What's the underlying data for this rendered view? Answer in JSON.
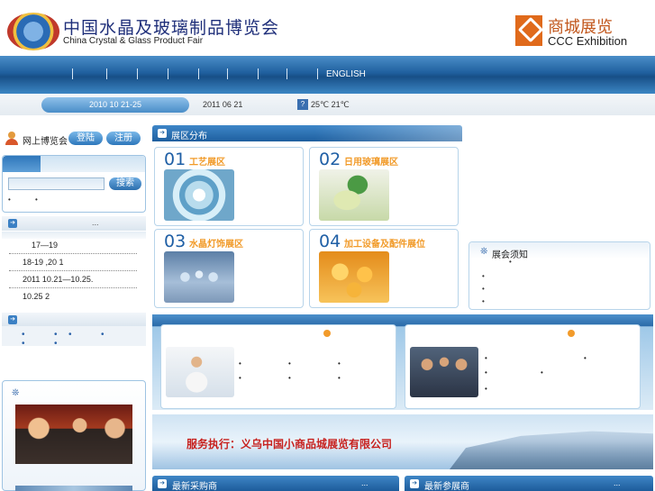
{
  "header": {
    "logo_cn": "中国水晶及玻璃制品博览会",
    "logo_en": "China Crystal &  Glass Product Fair",
    "partner_cn": "商城展览",
    "partner_en": "CCC Exhibition"
  },
  "nav": {
    "items": [
      "|",
      "|",
      "|",
      "|",
      "|",
      "|",
      "|",
      "|",
      "|"
    ],
    "english": "ENGLISH"
  },
  "datebar": {
    "fair_dates": "2010 10 21-25",
    "today": "2011 06 21",
    "weather_icon": "weather-icon",
    "weather": "25℃ 21℃"
  },
  "left": {
    "online_label": "网上博览会",
    "login": "登陆",
    "register": "注册",
    "search_button": "搜索",
    "search_dots": [
      "•",
      "•"
    ],
    "news_more": "...",
    "news": [
      "17—19",
      "18-19 ,20   1",
      "2011 10.21—10.25.",
      "10.25   2"
    ],
    "links": [
      "•",
      "•",
      "•",
      "•",
      "•",
      "•"
    ],
    "photo_icon": "❊"
  },
  "zones": {
    "header_title": "展区分布",
    "items": [
      {
        "num": "01",
        "name": "工艺展区"
      },
      {
        "num": "02",
        "name": "日用玻璃展区"
      },
      {
        "num": "03",
        "name": "水晶灯饰展区"
      },
      {
        "num": "04",
        "name": "加工设备及配件展位"
      }
    ]
  },
  "notice": {
    "icon": "❊",
    "title": "展会须知",
    "lines": [
      "•",
      "•",
      "•",
      "•"
    ]
  },
  "panels": {
    "left_dots": [
      "•",
      "•",
      "•",
      "•",
      "•",
      "•"
    ],
    "right_dots": [
      "•",
      "•",
      "•",
      "•",
      "•"
    ]
  },
  "banner": {
    "exec_text": "服务执行：义乌中国小商品城展览有限公司"
  },
  "bottom": {
    "buyers": "最新采购商",
    "exhibitors": "最新参展商",
    "more": "..."
  }
}
